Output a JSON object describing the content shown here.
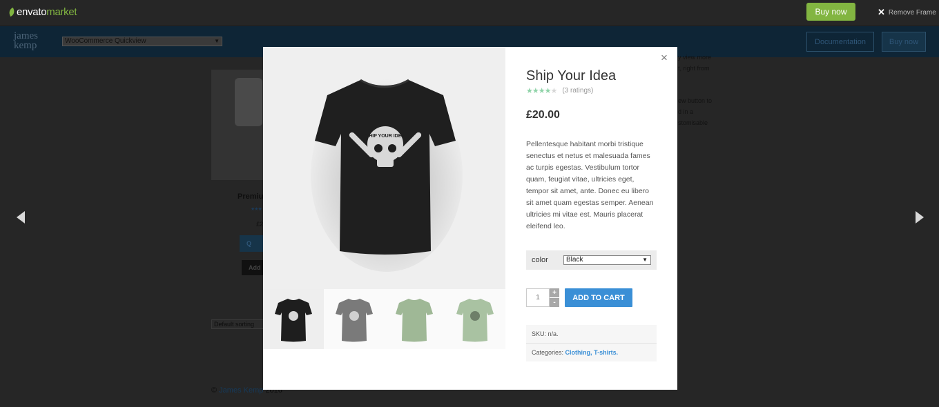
{
  "envato_bar": {
    "logo_main": "envato",
    "logo_market": "market",
    "buy_now": "Buy now",
    "remove_frame": "Remove Frame",
    "accent": "#82b541"
  },
  "site_header": {
    "logo": "james kemp",
    "theme_select_value": "WooCommerce Quickview",
    "documentation": "Documentation",
    "buy_now": "Buy now"
  },
  "background_page": {
    "product_title": "Premiu",
    "price": "£2",
    "quickview_button": "Q",
    "add_button": "Add",
    "sorting": "Default sorting",
    "right_text": [
      "y view more",
      "t, right from",
      "ew button to",
      "d in a",
      "stomisable"
    ],
    "footer_symbol": "©",
    "footer_link": "James Kemp",
    "footer_year": "2016"
  },
  "modal": {
    "close": "×",
    "product": {
      "title": "Ship Your Idea",
      "rating_stars": 4.5,
      "rating_count": "(3 ratings)",
      "price": "£20.00",
      "description": "Pellentesque habitant morbi tristique senectus et netus et malesuada fames ac turpis egestas. Vestibulum tortor quam, feugiat vitae, ultricies eget, tempor sit amet, ante. Donec eu libero sit amet quam egestas semper. Aenean ultricies mi vitae est. Mauris placerat eleifend leo.",
      "variation_label": "color",
      "variation_value": "Black",
      "quantity": "1",
      "qty_plus": "+",
      "qty_minus": "-",
      "add_to_cart": "ADD TO CART",
      "sku_label": "SKU:",
      "sku_value": "n/a.",
      "categories_label": "Categories:",
      "category_1": "Clothing",
      "category_sep": ",",
      "category_2": "T-shirts",
      "category_end": ".",
      "main_image_text": "SHIP YOUR IDEA",
      "thumbnails": [
        {
          "color": "#1e1e1e"
        },
        {
          "color": "#7a7a7a"
        },
        {
          "color": "#9fb896"
        },
        {
          "color": "#a9c2a2"
        }
      ],
      "colors": {
        "rating": "#8fd3a8",
        "button": "#3a8fd6"
      }
    }
  }
}
